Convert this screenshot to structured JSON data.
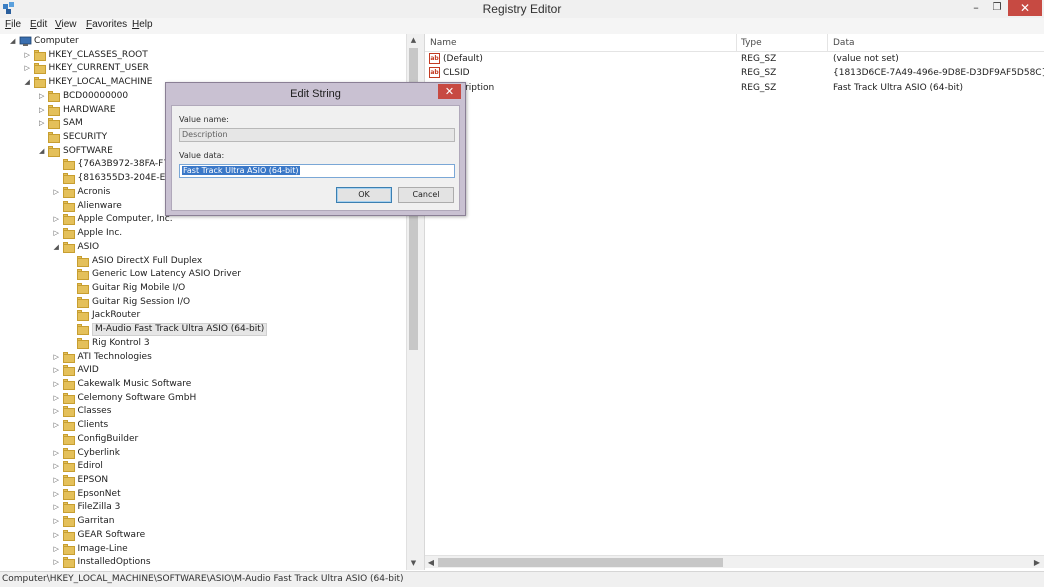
{
  "window": {
    "title": "Registry Editor",
    "minimize_glyph": "–",
    "maximize_glyph": "❐",
    "close_glyph": "✕"
  },
  "menu": [
    {
      "u": "F",
      "rest": "ile"
    },
    {
      "u": "E",
      "rest": "dit"
    },
    {
      "u": "V",
      "rest": "iew"
    },
    {
      "u": "F",
      "rest": "avorites"
    },
    {
      "u": "H",
      "rest": "elp"
    }
  ],
  "tree": [
    {
      "label": "Computer",
      "depth": 0,
      "state": "expanded",
      "icon": "computer-icon"
    },
    {
      "label": "HKEY_CLASSES_ROOT",
      "depth": 1,
      "state": "collapsed"
    },
    {
      "label": "HKEY_CURRENT_USER",
      "depth": 1,
      "state": "collapsed"
    },
    {
      "label": "HKEY_LOCAL_MACHINE",
      "depth": 1,
      "state": "expanded"
    },
    {
      "label": "BCD00000000",
      "depth": 2,
      "state": "collapsed"
    },
    {
      "label": "HARDWARE",
      "depth": 2,
      "state": "collapsed"
    },
    {
      "label": "SAM",
      "depth": 2,
      "state": "collapsed"
    },
    {
      "label": "SECURITY",
      "depth": 2,
      "state": "none"
    },
    {
      "label": "SOFTWARE",
      "depth": 2,
      "state": "expanded"
    },
    {
      "label": "{76A3B972-38FA-F7D1",
      "depth": 3,
      "state": "none"
    },
    {
      "label": "{816355D3-204E-E08E",
      "depth": 3,
      "state": "none"
    },
    {
      "label": "Acronis",
      "depth": 3,
      "state": "collapsed"
    },
    {
      "label": "Alienware",
      "depth": 3,
      "state": "none"
    },
    {
      "label": "Apple Computer, Inc.",
      "depth": 3,
      "state": "collapsed"
    },
    {
      "label": "Apple Inc.",
      "depth": 3,
      "state": "collapsed"
    },
    {
      "label": "ASIO",
      "depth": 3,
      "state": "expanded"
    },
    {
      "label": "ASIO DirectX Full Duplex",
      "depth": 4,
      "state": "none"
    },
    {
      "label": "Generic Low Latency ASIO Driver",
      "depth": 4,
      "state": "none"
    },
    {
      "label": "Guitar Rig Mobile I/O",
      "depth": 4,
      "state": "none"
    },
    {
      "label": "Guitar Rig Session I/O",
      "depth": 4,
      "state": "none"
    },
    {
      "label": "JackRouter",
      "depth": 4,
      "state": "none"
    },
    {
      "label": "M-Audio Fast Track Ultra ASIO (64-bit)",
      "depth": 4,
      "state": "none",
      "selected": true
    },
    {
      "label": "Rig Kontrol 3",
      "depth": 4,
      "state": "none"
    },
    {
      "label": "ATI Technologies",
      "depth": 3,
      "state": "collapsed"
    },
    {
      "label": "AVID",
      "depth": 3,
      "state": "collapsed"
    },
    {
      "label": "Cakewalk Music Software",
      "depth": 3,
      "state": "collapsed"
    },
    {
      "label": "Celemony Software GmbH",
      "depth": 3,
      "state": "collapsed"
    },
    {
      "label": "Classes",
      "depth": 3,
      "state": "collapsed"
    },
    {
      "label": "Clients",
      "depth": 3,
      "state": "collapsed"
    },
    {
      "label": "ConfigBuilder",
      "depth": 3,
      "state": "none"
    },
    {
      "label": "Cyberlink",
      "depth": 3,
      "state": "collapsed"
    },
    {
      "label": "Edirol",
      "depth": 3,
      "state": "collapsed"
    },
    {
      "label": "EPSON",
      "depth": 3,
      "state": "collapsed"
    },
    {
      "label": "EpsonNet",
      "depth": 3,
      "state": "collapsed"
    },
    {
      "label": "FileZilla 3",
      "depth": 3,
      "state": "collapsed"
    },
    {
      "label": "Garritan",
      "depth": 3,
      "state": "collapsed"
    },
    {
      "label": "GEAR Software",
      "depth": 3,
      "state": "collapsed"
    },
    {
      "label": "Image-Line",
      "depth": 3,
      "state": "collapsed"
    },
    {
      "label": "InstalledOptions",
      "depth": 3,
      "state": "collapsed"
    }
  ],
  "list": {
    "columns": [
      "Name",
      "Type",
      "Data"
    ],
    "rows": [
      {
        "name": "(Default)",
        "type": "REG_SZ",
        "data": "(value not set)"
      },
      {
        "name": "CLSID",
        "type": "REG_SZ",
        "data": "{1813D6CE-7A49-496e-9D8E-D3DF9AF5D58C}"
      },
      {
        "name": "Description",
        "type": "REG_SZ",
        "data": "Fast Track Ultra ASIO (64-bit)"
      }
    ]
  },
  "dialog": {
    "title": "Edit String",
    "value_name_label": "Value name:",
    "value_name": "Description",
    "value_data_label": "Value data:",
    "value_data": "Fast Track Ultra ASIO (64-bit)",
    "ok_label": "OK",
    "cancel_label": "Cancel"
  },
  "status": "Computer\\HKEY_LOCAL_MACHINE\\SOFTWARE\\ASIO\\M-Audio Fast Track Ultra ASIO (64-bit)",
  "colors": {
    "close_button": "#c74a42",
    "dialog_frame": "#c9c1d2",
    "selection": "#3a78c8",
    "folder": "#e4c05a"
  }
}
